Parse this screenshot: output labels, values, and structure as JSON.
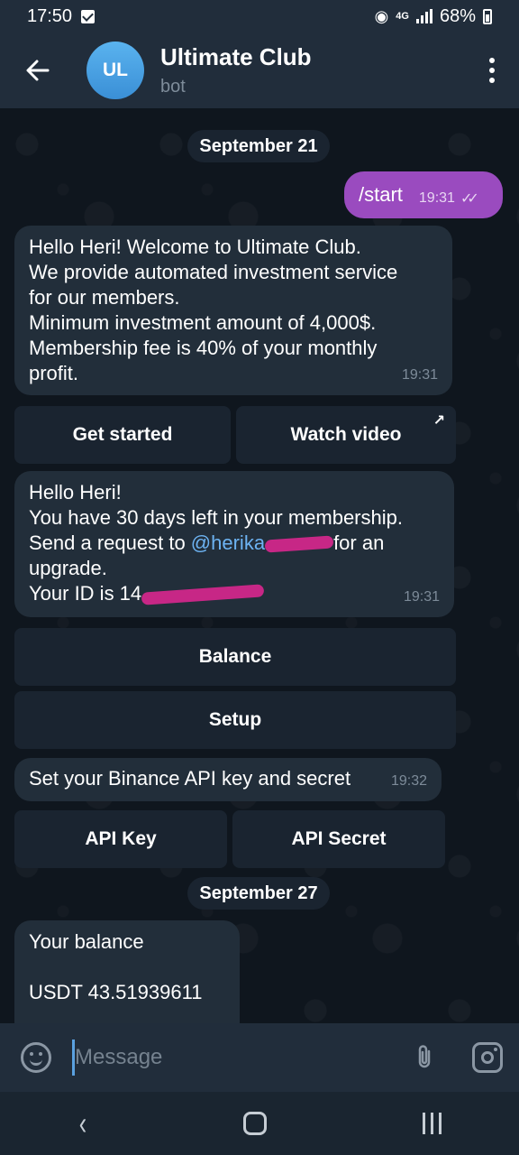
{
  "status_bar": {
    "time": "17:50",
    "network": "4G",
    "battery": "68%"
  },
  "header": {
    "avatar_initials": "UL",
    "title": "Ultimate Club",
    "subtitle": "bot"
  },
  "chat": {
    "date_1": "September 21",
    "outgoing_message": {
      "text": "/start",
      "time": "19:31"
    },
    "message_1": {
      "lines": [
        "Hello Heri! Welcome to Ultimate Club.",
        "We provide automated investment service",
        "for our members.",
        "Minimum investment amount of 4,000$.",
        "Membership fee is 40% of your monthly",
        "profit."
      ],
      "time": "19:31"
    },
    "keyboard_1": {
      "get_started": "Get started",
      "watch_video": "Watch video"
    },
    "message_2": {
      "line1": "Hello Heri!",
      "line2": "You have 30 days left in your membership.",
      "line3_prefix": "Send a request to ",
      "mention": "@herika",
      "line3_suffix": "for an",
      "line4": "upgrade.",
      "line5_prefix": "Your ID is 14",
      "time": "19:31"
    },
    "keyboard_2": {
      "balance": "Balance",
      "setup": "Setup"
    },
    "message_3": {
      "text": "Set your Binance API key and secret",
      "time": "19:32"
    },
    "keyboard_3": {
      "api_key": "API Key",
      "api_secret": "API Secret"
    },
    "date_2": "September 27",
    "message_4": {
      "line1": "Your balance",
      "line2": "USDT 43.51939611"
    }
  },
  "input": {
    "placeholder": "Message"
  },
  "colors": {
    "outgoing_bubble": "#9a4bbf",
    "incoming_bubble": "#222e3a",
    "header": "#212d3b",
    "background": "#0f161e",
    "link": "#6db3f2",
    "redaction": "#d9278f"
  }
}
